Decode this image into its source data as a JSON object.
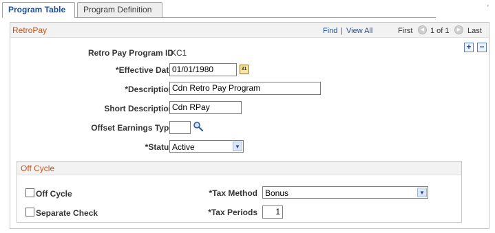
{
  "tabs": [
    {
      "label": "Program Table",
      "active": true
    },
    {
      "label": "Program Definition",
      "active": false
    }
  ],
  "corner_mark": "'",
  "group": {
    "title": "RetroPay",
    "find_label": "Find",
    "separator": "|",
    "view_all_label": "View All",
    "first_label": "First",
    "page_info": "1 of 1",
    "last_label": "Last",
    "add_row": "+",
    "delete_row": "−"
  },
  "form": {
    "program_id_label": "Retro Pay Program ID",
    "program_id_value": "KC1",
    "effective_date_label": "*Effective Date",
    "effective_date_value": "01/01/1980",
    "calendar_icon_text": "31",
    "description_label": "*Description",
    "description_value": "Cdn Retro Pay Program",
    "short_description_label": "Short Description",
    "short_description_value": "Cdn RPay",
    "offset_earnings_label": "Offset Earnings Type",
    "offset_earnings_value": "",
    "status_label": "*Status",
    "status_value": "Active"
  },
  "off_cycle": {
    "title": "Off Cycle",
    "off_cycle_label": "Off Cycle",
    "off_cycle_checked": false,
    "separate_check_label": "Separate Check",
    "separate_check_checked": false,
    "tax_method_label": "*Tax Method",
    "tax_method_value": "Bonus",
    "tax_periods_label": "*Tax Periods",
    "tax_periods_value": "1"
  },
  "colors": {
    "group_title": "#c0551f",
    "link": "#1b4f9c",
    "header_bg": "#f2f2f2",
    "border": "#c7c7c7"
  },
  "icons": {
    "calendar": "calendar-icon",
    "lookup": "magnifier-icon",
    "dropdown": "chevron-down-icon",
    "first": "left-arrow-icon",
    "last": "right-arrow-icon"
  }
}
